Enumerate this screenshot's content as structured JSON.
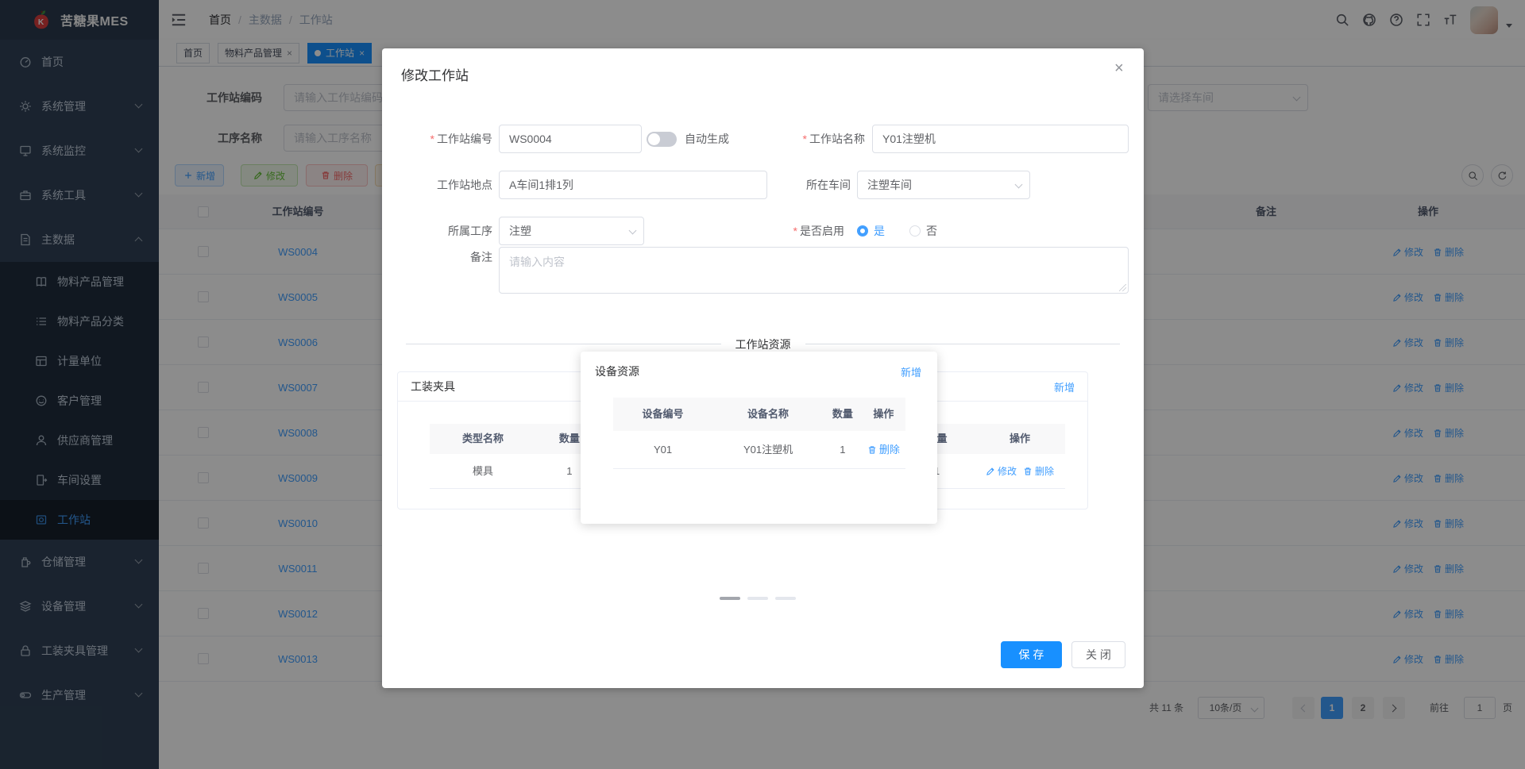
{
  "colors": {
    "accent": "#409eff",
    "active_tab": "#1890ff",
    "save_button": "#1890ff",
    "danger": "#f56c6c",
    "success": "#67c23a",
    "warning": "#e6a23c",
    "sidebar_bg": "#304156",
    "submenu_bg": "#1f2d3d"
  },
  "app": {
    "logo_title": "苦糖果MES"
  },
  "header": {
    "breadcrumb": [
      "首页",
      "主数据",
      "工作站"
    ]
  },
  "tabs": [
    {
      "label": "首页"
    },
    {
      "label": "物料产品管理"
    },
    {
      "label": "工作站"
    }
  ],
  "sidebar": {
    "items": [
      {
        "label": "首页",
        "icon": "dashboard-icon"
      },
      {
        "label": "系统管理",
        "icon": "gear-icon"
      },
      {
        "label": "系统监控",
        "icon": "monitor-icon"
      },
      {
        "label": "系统工具",
        "icon": "toolbox-icon"
      },
      {
        "label": "主数据",
        "icon": "document-icon",
        "expanded": true
      },
      {
        "label": "物料产品管理",
        "icon": "book-icon"
      },
      {
        "label": "物料产品分类",
        "icon": "list-icon"
      },
      {
        "label": "计量单位",
        "icon": "unit-box-icon"
      },
      {
        "label": "客户管理",
        "icon": "face-icon"
      },
      {
        "label": "供应商管理",
        "icon": "user-icon"
      },
      {
        "label": "车间设置",
        "icon": "door-icon"
      },
      {
        "label": "工作站",
        "icon": "workstation-icon",
        "active": true
      },
      {
        "label": "仓储管理",
        "icon": "storage-icon"
      },
      {
        "label": "设备管理",
        "icon": "layers-icon"
      },
      {
        "label": "工装夹具管理",
        "icon": "lock-icon"
      },
      {
        "label": "生产管理",
        "icon": "toggle-icon"
      }
    ]
  },
  "filters": {
    "code_label": "工作站编码",
    "code_placeholder": "请输入工作站编码",
    "process_label": "工序名称",
    "process_placeholder": "请输入工序名称",
    "workshop_placeholder": "请选择车间"
  },
  "toolbar": {
    "add_label": "新增",
    "edit_label": "修改",
    "delete_label": "删除",
    "export_label": ""
  },
  "table": {
    "header_code": "工作站编号",
    "header_remark": "备注",
    "header_action": "操作",
    "edit_label": "修改",
    "delete_label": "删除",
    "rows": [
      {
        "code": "WS0004"
      },
      {
        "code": "WS0005"
      },
      {
        "code": "WS0006"
      },
      {
        "code": "WS0007"
      },
      {
        "code": "WS0008"
      },
      {
        "code": "WS0009"
      },
      {
        "code": "WS0010"
      },
      {
        "code": "WS0011"
      },
      {
        "code": "WS0012"
      },
      {
        "code": "WS0013"
      }
    ]
  },
  "pagination": {
    "total": "共 11 条",
    "page_size": "10条/页",
    "pages": [
      "1",
      "2"
    ],
    "active_page": "1",
    "goto_label": "前往",
    "goto_value": "1",
    "page_unit": "页"
  },
  "modal": {
    "title": "修改工作站",
    "code_label": "工作站编号",
    "code_value": "WS0004",
    "autogen_label": "自动生成",
    "name_label": "工作站名称",
    "name_value": "Y01注塑机",
    "location_label": "工作站地点",
    "location_value": "A车间1排1列",
    "workshop_label": "所在车间",
    "workshop_value": "注塑车间",
    "process_label": "所属工序",
    "process_value": "注塑",
    "enable_label": "是否启用",
    "enable_yes": "是",
    "enable_no": "否",
    "remark_label": "备注",
    "remark_placeholder": "请输入内容",
    "section_title": "工作站资源",
    "fixture_card": {
      "title": "工装夹具",
      "add_label": "新增",
      "col_type": "类型名称",
      "col_qty": "数量",
      "col_action": "操作",
      "row_type": "模具",
      "row_qty": "1",
      "edit_label": "修改",
      "delete_label": "删除"
    },
    "resource_card": {
      "add_label": "新增",
      "col_type": "",
      "col_qty": "数量",
      "col_action": "操作",
      "row_type": "",
      "row_qty": "1",
      "edit_label": "修改",
      "delete_label": "删除"
    },
    "save_label": "保 存",
    "close_label": "关 闭"
  },
  "popup": {
    "title": "设备资源",
    "add_label": "新增",
    "col_code": "设备编号",
    "col_name": "设备名称",
    "col_qty": "数量",
    "col_action": "操作",
    "row_code": "Y01",
    "row_name": "Y01注塑机",
    "row_qty": "1",
    "delete_label": "删除"
  }
}
